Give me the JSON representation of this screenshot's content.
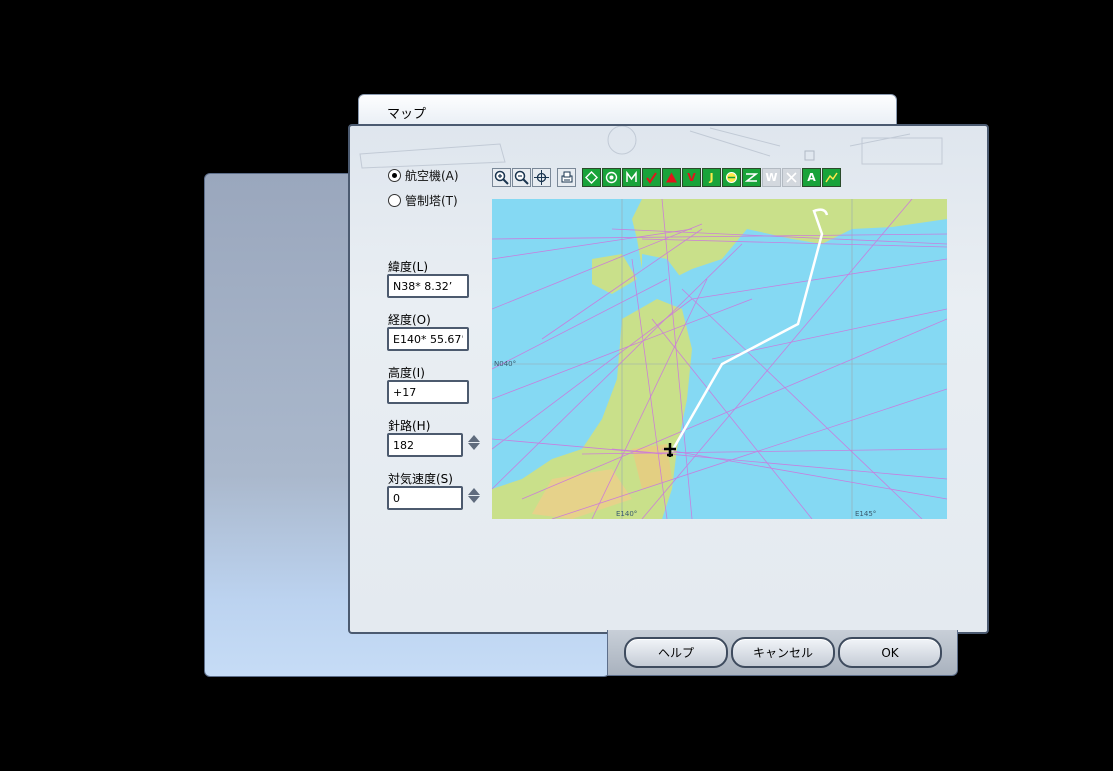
{
  "window": {
    "title": "マップ"
  },
  "view_mode": {
    "options": [
      {
        "label": "航空機(A)",
        "checked": true
      },
      {
        "label": "管制塔(T)",
        "checked": false
      }
    ]
  },
  "fields": {
    "latitude": {
      "label": "緯度(L)",
      "value": "N38* 8.32’"
    },
    "longitude": {
      "label": "経度(O)",
      "value": "E140* 55.67’"
    },
    "altitude": {
      "label": "高度(I)",
      "value": "+17"
    },
    "heading": {
      "label": "針路(H)",
      "value": "182"
    },
    "airspeed": {
      "label": "対気速度(S)",
      "value": "0"
    }
  },
  "toolbar": {
    "zoom_in": "zoom-in-icon",
    "zoom_out": "zoom-out-icon",
    "center": "center-aircraft-icon",
    "print": "print-icon",
    "vor_letter": "",
    "ndb_letter": "",
    "ils_letter": "",
    "v_letter": "V",
    "j_letter": "J",
    "w_letter": "W",
    "a_letter": "A",
    "colors": {
      "green": "#19a33a",
      "red": "#e0141a",
      "yellow": "#ffe94a"
    }
  },
  "map": {
    "grid_labels": {
      "lat": "N040°",
      "lon1": "E140°",
      "lon2": "E145°"
    },
    "colors": {
      "sea": "#85d9f3",
      "land": "#c9e08a",
      "airways": "#cc77dd",
      "route": "#ffffff"
    }
  },
  "buttons": {
    "help": "ヘルプ",
    "cancel": "キャンセル",
    "ok": "OK"
  }
}
